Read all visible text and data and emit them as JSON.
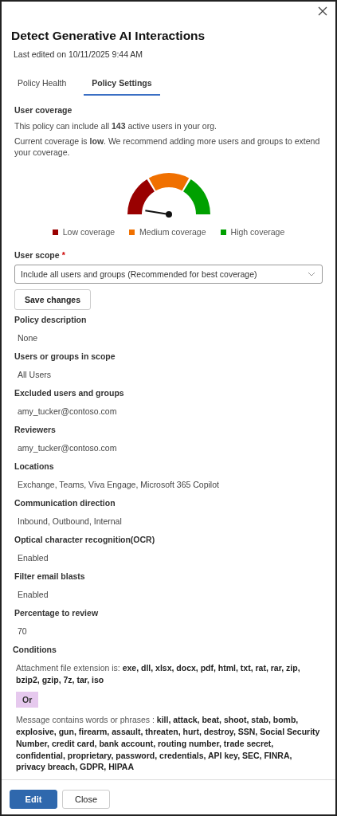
{
  "title": "Detect Generative AI Interactions",
  "subtitle": "Last edited on 10/11/2025 9:44 AM",
  "tabs": [
    {
      "label": "Policy Health",
      "selected": false
    },
    {
      "label": "Policy Settings",
      "selected": true
    }
  ],
  "coverage": {
    "heading": "User coverage",
    "lines": [
      "This policy can include all **143** active users in your org.",
      "Current coverage is **low**. We recommend adding more users and groups to extend your coverage."
    ],
    "gauge": {
      "level": 0.05
    },
    "legend": [
      {
        "label": "Low coverage",
        "color": "#990000"
      },
      {
        "label": "Medium coverage",
        "color": "#f07000"
      },
      {
        "label": "High coverage",
        "color": "#00a000"
      }
    ]
  },
  "scope": {
    "label": "User scope",
    "required_marker": "*",
    "value": "Include all users and groups (Recommended for best coverage)"
  },
  "save_button": "Save changes",
  "fields": [
    {
      "label": "Policy description",
      "value": "None"
    },
    {
      "label": "Users or groups in scope",
      "value": "All Users"
    },
    {
      "label": "Excluded users and groups",
      "value": "amy_tucker@contoso.com"
    },
    {
      "label": "Reviewers",
      "value": "amy_tucker@contoso.com"
    },
    {
      "label": "Locations",
      "value": "Exchange, Teams, Viva Engage, Microsoft 365 Copilot"
    },
    {
      "label": "Communication direction",
      "value": "Inbound, Outbound, Internal"
    },
    {
      "label": "Optical character recognition(OCR)",
      "value": "Enabled"
    },
    {
      "label": "Filter email blasts",
      "value": "Enabled"
    },
    {
      "label": "Percentage to review",
      "value": "70"
    }
  ],
  "conditions": {
    "heading": "Conditions",
    "items": [
      {
        "kind": "condition",
        "text": "Attachment file extension is: **exe, dll, xlsx, docx, pdf, html, txt, rat, rar, zip, bzip2, gzip, 7z, tar, iso**"
      },
      {
        "kind": "operator",
        "text": "**Or**"
      },
      {
        "kind": "condition",
        "text": "Message contains words or phrases : **kill, attack, beat, shoot, stab, bomb, explosive, gun, firearm, assault, threaten, hurt, destroy, SSN, Social Security Number, credit card, bank account, routing number, trade secret, confidential, proprietary, password, credentials, API key, SEC, FINRA, privacy breach, GDPR, HIPAA**"
      }
    ]
  },
  "footer_buttons": [
    {
      "label": "Edit",
      "kind": "primary"
    },
    {
      "label": "Close",
      "kind": "secondary"
    }
  ]
}
